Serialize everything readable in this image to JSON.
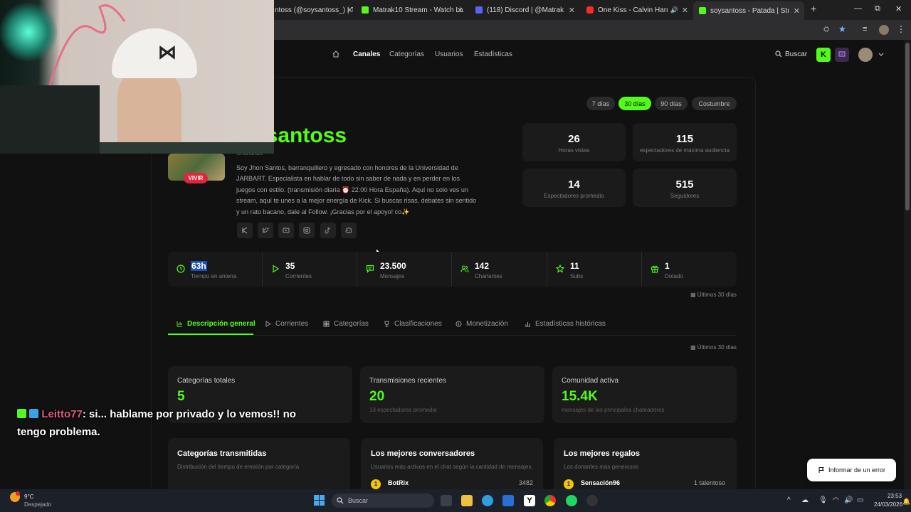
{
  "browser": {
    "tabs": [
      {
        "title": "ntoss (@soysantoss_) | Ti",
        "color": "#e94f4f"
      },
      {
        "title": "Matrak10 Stream - Watch Live",
        "color": "#53fc18"
      },
      {
        "title": "(118) Discord | @Matrak",
        "color": "#5865f2"
      },
      {
        "title": "One Kiss - Calvin Harris, Du",
        "color": "#ff2b2b"
      },
      {
        "title": "soysantoss - Patada | Streamer",
        "color": "#53fc18"
      }
    ],
    "new_tab": "+",
    "window_controls": {
      "minimize": "—",
      "restore": "⧉",
      "close": "✕"
    }
  },
  "nav": {
    "items": [
      "Canales",
      "Categorías",
      "Usuarios",
      "Estadísticas"
    ],
    "search_label": "Buscar"
  },
  "profile": {
    "name_visible": "ysantoss",
    "category_line": "Charlando",
    "live_badge": "VIVIR",
    "bio": "Soy Jhon Santos, barranquillero y egresado con honores de la Universidad de JARBART. Especialista en hablar de todo sin saber de nada y en perder en los juegos con estilo. (transmisión diaria ⏰ 22:00 Hora España). Aquí no solo ves un stream, aquí te unes a la mejor energía de Kick. Si buscas risas, debates sin sentido y un rato bacano, dale al Follow. ¡Gracias por el apoyo! co✨"
  },
  "period_filters": [
    "7 días",
    "30 días",
    "90 días",
    "Costumbre"
  ],
  "summary_cards": [
    {
      "value": "26",
      "label": "Horas vistas"
    },
    {
      "value": "115",
      "label": "espectadores de máxima audiencia"
    },
    {
      "value": "14",
      "label": "Espectadores promedio"
    },
    {
      "value": "515",
      "label": "Seguidores"
    }
  ],
  "stats_row": [
    {
      "value": "63h",
      "label": "Tiempo en antena",
      "icon": "clock-icon"
    },
    {
      "value": "35",
      "label": "Corrientes",
      "icon": "play-icon"
    },
    {
      "value": "23.500",
      "label": "Mensajes",
      "icon": "message-icon"
    },
    {
      "value": "142",
      "label": "Charlantes",
      "icon": "users-icon"
    },
    {
      "value": "11",
      "label": "Subs",
      "icon": "star-icon"
    },
    {
      "value": "1",
      "label": "Dotado",
      "icon": "gift-icon"
    }
  ],
  "period_note": "Últimos 30 días",
  "content_tabs": [
    "Descripción general",
    "Corrientes",
    "Categorías",
    "Clasificaciones",
    "Monetización",
    "Estadísticas históricas"
  ],
  "overview_cards": [
    {
      "title": "Categorías totales",
      "value": "5",
      "sub": ""
    },
    {
      "title": "Transmisiones recientes",
      "value": "20",
      "sub": "13 espectadores promedio"
    },
    {
      "title": "Comunidad activa",
      "value": "15.4K",
      "sub": "mensajes de los principales chateadores"
    }
  ],
  "bottom_cards": [
    {
      "title": "Categorías transmitidas",
      "sub": "Distribución del tiempo de emisión por categoría"
    },
    {
      "title": "Los mejores conversadores",
      "sub": "Usuarios más activos en el chat según la cantidad de mensajes.",
      "row_name": "BotRix",
      "row_value": "3482",
      "rank": "1"
    },
    {
      "title": "Los mejores regalos",
      "sub": "Los donantes más generosos",
      "row_name": "Sensación96",
      "row_value": "1 talentoso",
      "rank": "1"
    }
  ],
  "report_button": "Informar de un error",
  "chat_overlay": {
    "user": "Leitto77",
    "message": ": si... hablame por privado y lo vemos!! no tengo problema."
  },
  "taskbar": {
    "weather_temp": "9°C",
    "weather_desc": "Despejado",
    "search_placeholder": "Buscar",
    "time": "23:53",
    "date": "24/03/2026"
  },
  "colors": {
    "accent": "#53fc18",
    "background": "#111112",
    "card": "#1b1b1c"
  }
}
